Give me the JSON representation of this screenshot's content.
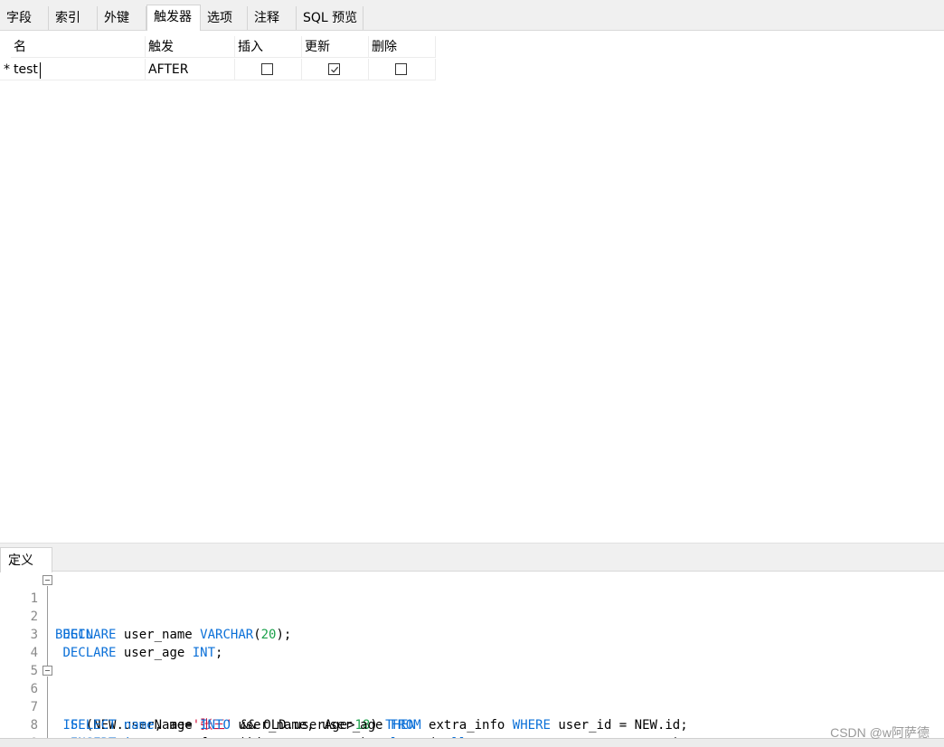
{
  "tabs": [
    "字段",
    "索引",
    "外键",
    "触发器",
    "选项",
    "注释",
    "SQL 预览"
  ],
  "active_tab": "触发器",
  "grid": {
    "headers": [
      "名",
      "触发",
      "插入",
      "更新",
      "删除"
    ],
    "row": {
      "marker": "*",
      "name": "test",
      "timing": "AFTER",
      "insert": false,
      "update": true,
      "delete": false
    }
  },
  "definition": {
    "tab_label": "定义",
    "line_numbers": [
      "1",
      "2",
      "3",
      "4",
      "5",
      "6",
      "7",
      "8",
      "9"
    ]
  },
  "watermark": "CSDN @w阿萨德",
  "colors": {
    "keyword": "#0b70d8",
    "number": "#1aa04a",
    "string": "#d0103a"
  }
}
